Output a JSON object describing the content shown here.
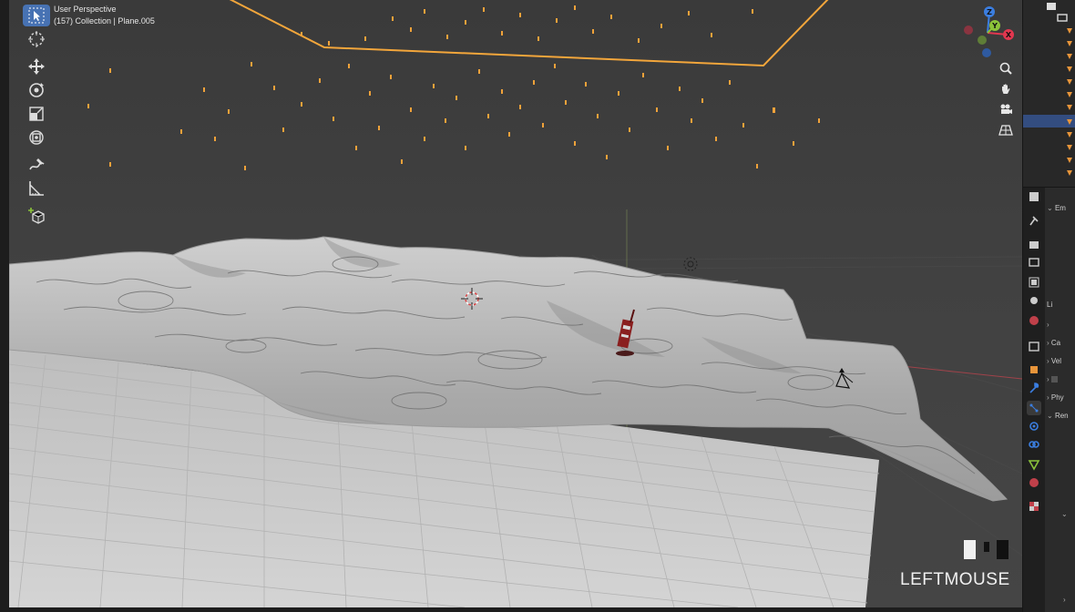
{
  "viewport": {
    "view_name": "User Perspective",
    "collection_info": "(157) Collection | Plane.005"
  },
  "toolbar": {
    "tools": [
      {
        "name": "select-box",
        "active": true
      },
      {
        "name": "cursor",
        "active": false
      },
      {
        "name": "move",
        "active": false
      },
      {
        "name": "rotate",
        "active": false
      },
      {
        "name": "scale",
        "active": false
      },
      {
        "name": "transform",
        "active": false
      },
      {
        "name": "annotate",
        "active": false
      },
      {
        "name": "measure",
        "active": false
      },
      {
        "name": "add-cube",
        "active": false
      }
    ]
  },
  "gizmo": {
    "axes": [
      "X",
      "Y",
      "Z"
    ],
    "x_color": "#e2374f",
    "y_color": "#8bc33a",
    "z_color": "#3b7ee0"
  },
  "keycast": {
    "label": "LEFTMOUSE"
  },
  "properties": {
    "panels": [
      "Em",
      "Ca",
      "Vel",
      "Phy",
      "Ren"
    ],
    "sub_label": "Li"
  },
  "colors": {
    "accent": "#4772b3",
    "selection_outline": "#f3a63b",
    "viewport_bg": "#3d3d3d",
    "ground": "#c9c9c9",
    "terrain": "#b5b5b5"
  }
}
